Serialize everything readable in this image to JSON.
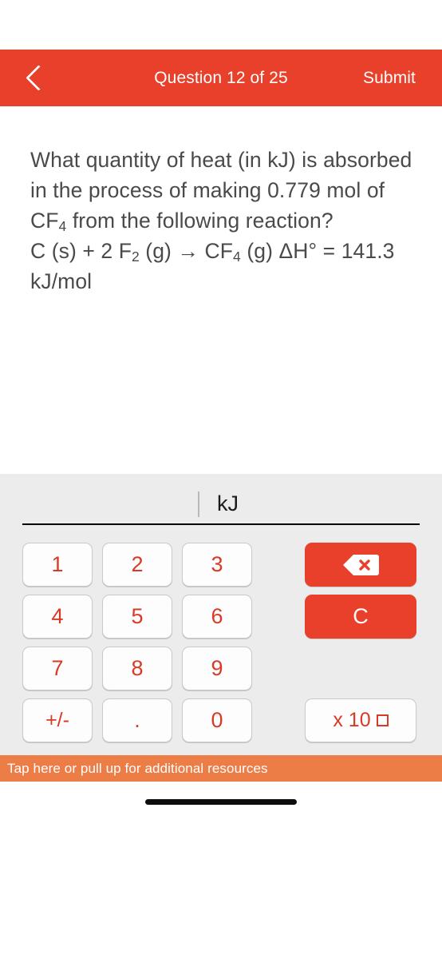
{
  "header": {
    "back_icon": "chevron-left-icon",
    "title": "Question 12 of 25",
    "submit_label": "Submit",
    "bg_color": "#E8402A"
  },
  "question": {
    "line1": "What quantity of heat (in kJ) is absorbed in the process of making 0.779 mol of CF",
    "sub1": "4",
    "line1_tail": " from the following reaction?",
    "eq_part1": "C (s) + 2 F",
    "eq_sub1": "2",
    "eq_part2": " (g) → CF",
    "eq_sub2": "4",
    "eq_part3": " (g) ΔH° = 141.3 kJ/mol"
  },
  "answer": {
    "value": "",
    "unit": "kJ",
    "caret_visible": true
  },
  "keypad": {
    "keys": [
      {
        "label": "1",
        "name": "key-1"
      },
      {
        "label": "2",
        "name": "key-2"
      },
      {
        "label": "3",
        "name": "key-3"
      },
      {
        "label": "4",
        "name": "key-4"
      },
      {
        "label": "5",
        "name": "key-5"
      },
      {
        "label": "6",
        "name": "key-6"
      },
      {
        "label": "7",
        "name": "key-7"
      },
      {
        "label": "8",
        "name": "key-8"
      },
      {
        "label": "9",
        "name": "key-9"
      },
      {
        "label": "+/-",
        "name": "key-plus-minus"
      },
      {
        "label": ".",
        "name": "key-decimal"
      },
      {
        "label": "0",
        "name": "key-0"
      }
    ],
    "backspace_icon": "backspace-icon",
    "clear_label": "C",
    "exponent_label": "x 10",
    "key_text_color": "#D93A26",
    "panel_bg": "#ECECEC"
  },
  "resources": {
    "label": "Tap here or pull up for additional resources",
    "bg_color": "#ED7D47"
  }
}
